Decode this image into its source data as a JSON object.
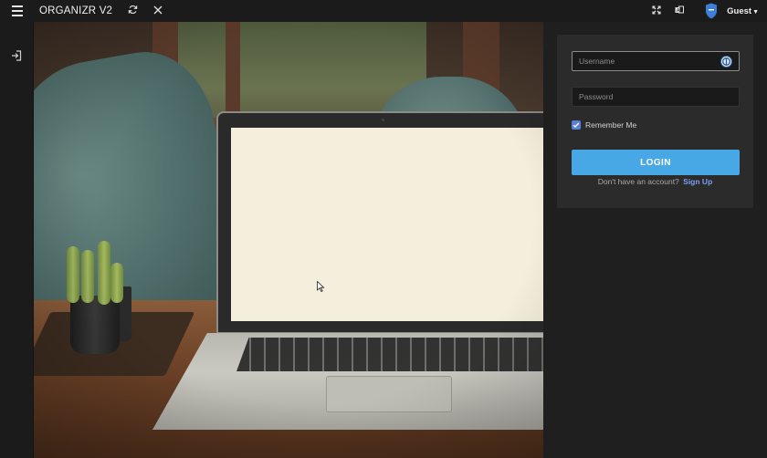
{
  "header": {
    "brand": "ORGANIZR V2",
    "user_label": "Guest",
    "icons": [
      "menu-icon",
      "refresh-icon",
      "close-icon",
      "fullscreen-icon",
      "language-icon",
      "shield-avatar-icon",
      "caret-down-icon"
    ]
  },
  "sidebar": {
    "icons": [
      "sign-in-icon"
    ]
  },
  "login": {
    "username_placeholder": "Username",
    "password_placeholder": "Password",
    "remember_label": "Remember Me",
    "remember_checked": true,
    "login_button": "LOGIN",
    "signup_prompt": "Don't have an account?",
    "signup_link": "Sign Up"
  },
  "colors": {
    "topbar": "#1b1b1b",
    "card": "#2b2b2b",
    "accent_button": "#47a8e5",
    "checkbox": "#5a7fd6",
    "link": "#7b9ff0"
  }
}
